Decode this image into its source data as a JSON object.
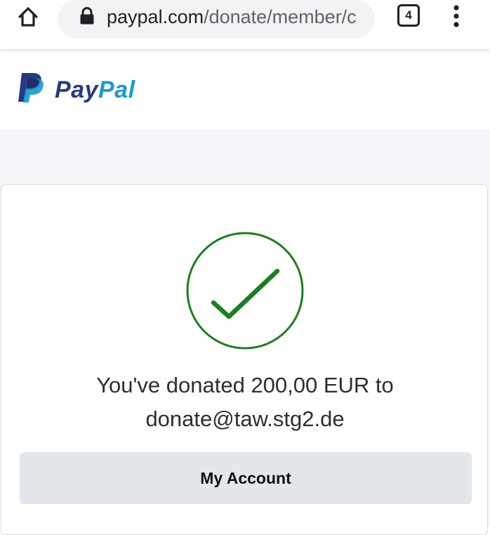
{
  "browser": {
    "url_host": "paypal.com",
    "url_path": "/donate/member/c",
    "tab_count": "4",
    "icons": {
      "home": "home-icon",
      "lock": "lock-icon",
      "menu": "more-vert-icon"
    }
  },
  "header": {
    "logo_word_1": "Pay",
    "logo_word_2": "Pal",
    "colors": {
      "brand_dark": "#253b80",
      "brand_light": "#179bd7"
    }
  },
  "confirmation": {
    "icon": "checkmark-icon",
    "status_color": "#1a7f1e",
    "message_line_1": "You've donated 200,00 EUR to",
    "message_line_2": "donate@taw.stg2.de",
    "button_label": "My Account"
  }
}
